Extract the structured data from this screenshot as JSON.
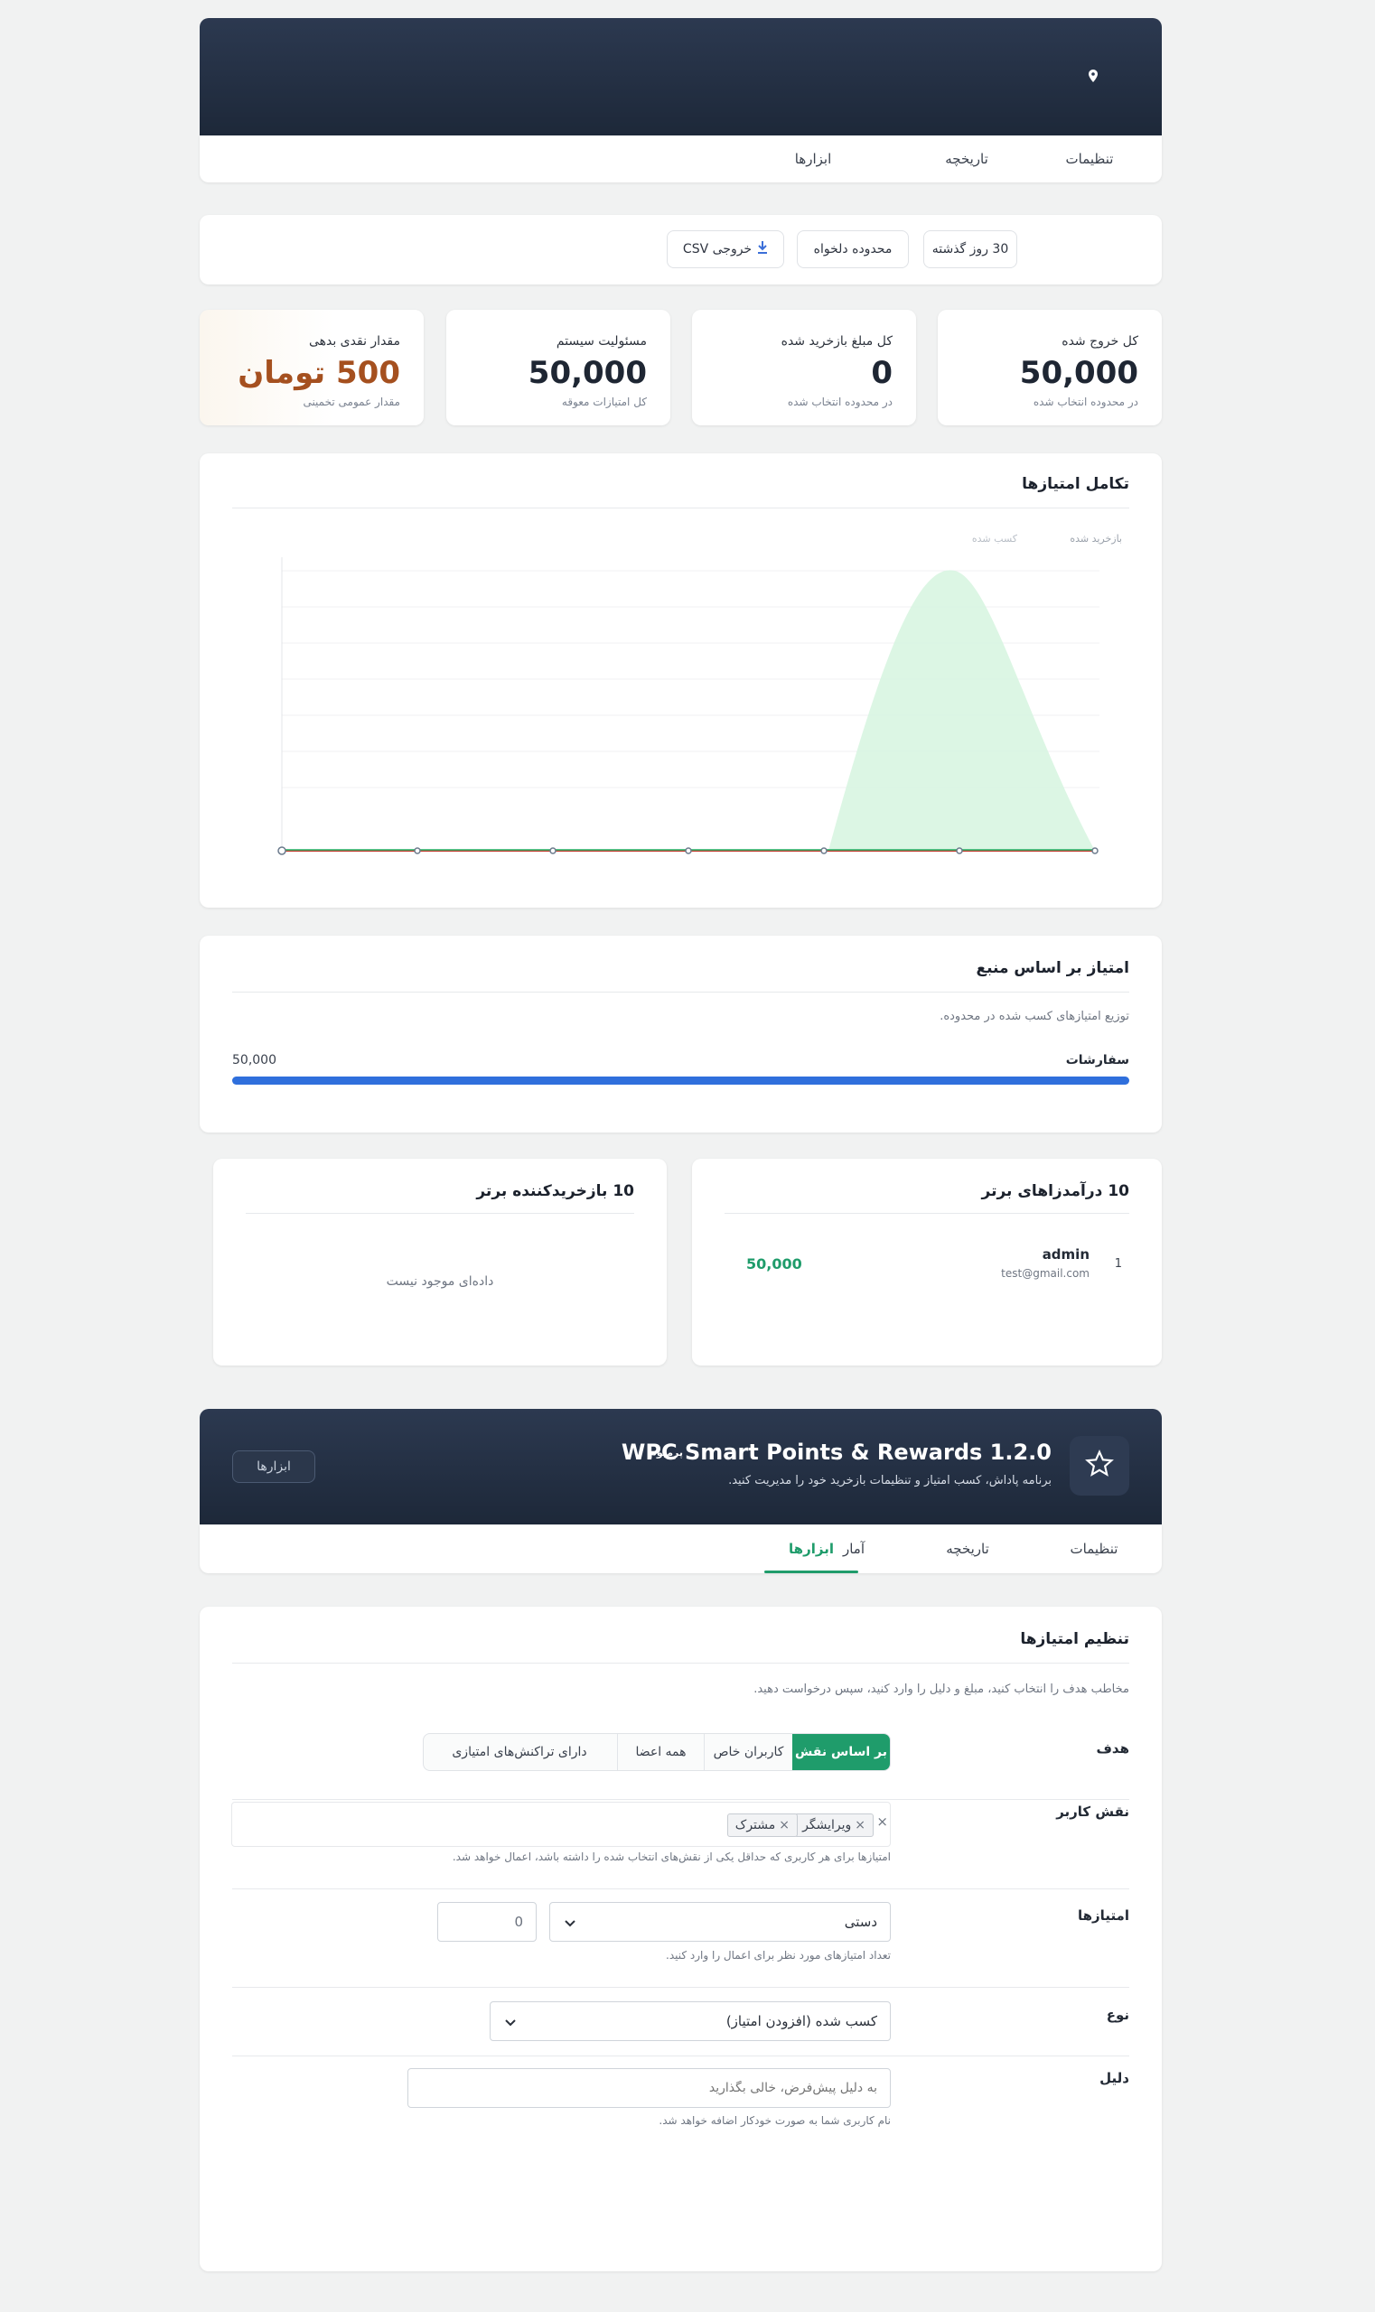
{
  "top_header": {
    "tabs": [
      "تنظیمات",
      "تاریخچه",
      "ابزارها"
    ]
  },
  "filters": {
    "range_30": "30 روز گذشته",
    "custom": "محدوده دلخواه",
    "export": "خروجی CSV"
  },
  "stats": [
    {
      "label": "کل خروج شده",
      "value": "50,000",
      "sub": "در محدوده انتخاب شده"
    },
    {
      "label": "کل مبلغ بازخرید شده",
      "value": "0",
      "sub": "در محدوده انتخاب شده"
    },
    {
      "label": "مسئولیت سیستم",
      "value": "50,000",
      "sub": "کل امتیازات معوقه"
    },
    {
      "label": "مقدار نقدی بدهی",
      "value": "500 تومان",
      "sub": "مقدار عمومی تخمینی"
    }
  ],
  "evolution": {
    "title": "تکامل امتیازها",
    "legend": [
      "بازخرید شده",
      "کسب شده"
    ],
    "colors": {
      "earned": "#2fb36b",
      "redeemed": "#c0392b",
      "area": "#d6f5df"
    }
  },
  "by_source": {
    "title": "امتیاز بر اساس منبع",
    "desc": "توزیع امتیازهای کسب شده در محدوده.",
    "rows": [
      {
        "label": "سفارشات",
        "value": "50,000",
        "fraction": 1.0
      }
    ],
    "bar_color": "#2f6fdc"
  },
  "top_earners": {
    "title": "10 درآمدزاهای برتر",
    "rows": [
      {
        "rank": "1",
        "name": "admin",
        "email": "test@gmail.com",
        "points": "50,000"
      }
    ]
  },
  "top_redeemers": {
    "title": "10 بازخریدکننده برتر",
    "empty": "داده‌ای موجود نیست"
  },
  "plugin": {
    "name": "WPC Smart Points & Rewards 1.2.0",
    "badge": "پرمیوم",
    "desc": "برنامه پاداش، کسب امتیاز و تنظیمات بازخرید خود را مدیریت کنید.",
    "button": "ابزارها",
    "tabs": [
      "تنظیمات",
      "تاریخچه",
      "آمار",
      "ابزارها"
    ],
    "active_tab": "ابزارها"
  },
  "adjust": {
    "title": "تنظیم امتیازها",
    "desc": "مخاطب هدف را انتخاب کنید، مبلغ و دلیل را وارد کنید، سپس درخواست دهید.",
    "target_label": "هدف",
    "target_options": [
      "بر اساس نقش",
      "کاربران خاص",
      "همه اعضا",
      "دارای تراکنش‌های امتیازی"
    ],
    "role_label": "نقش کاربر",
    "roles": [
      "ویرایشگر",
      "مشترک"
    ],
    "role_help": "امتیازها برای هر کاربری که حداقل یکی از نقش‌های انتخاب شده را داشته باشد، اعمال خواهد شد.",
    "points_label": "امتیازها",
    "points_mode": "دستی",
    "points_value": "0",
    "points_help": "تعداد امتیازهای مورد نظر برای اعمال را وارد کنید.",
    "type_label": "نوع",
    "type_value": "کسب شده (افزودن امتیاز)",
    "reason_label": "دلیل",
    "reason_placeholder": "به دلیل پیش‌فرض، خالی بگذارید",
    "reason_help": "نام کاربری شما به صورت خودکار اضافه خواهد شد."
  }
}
